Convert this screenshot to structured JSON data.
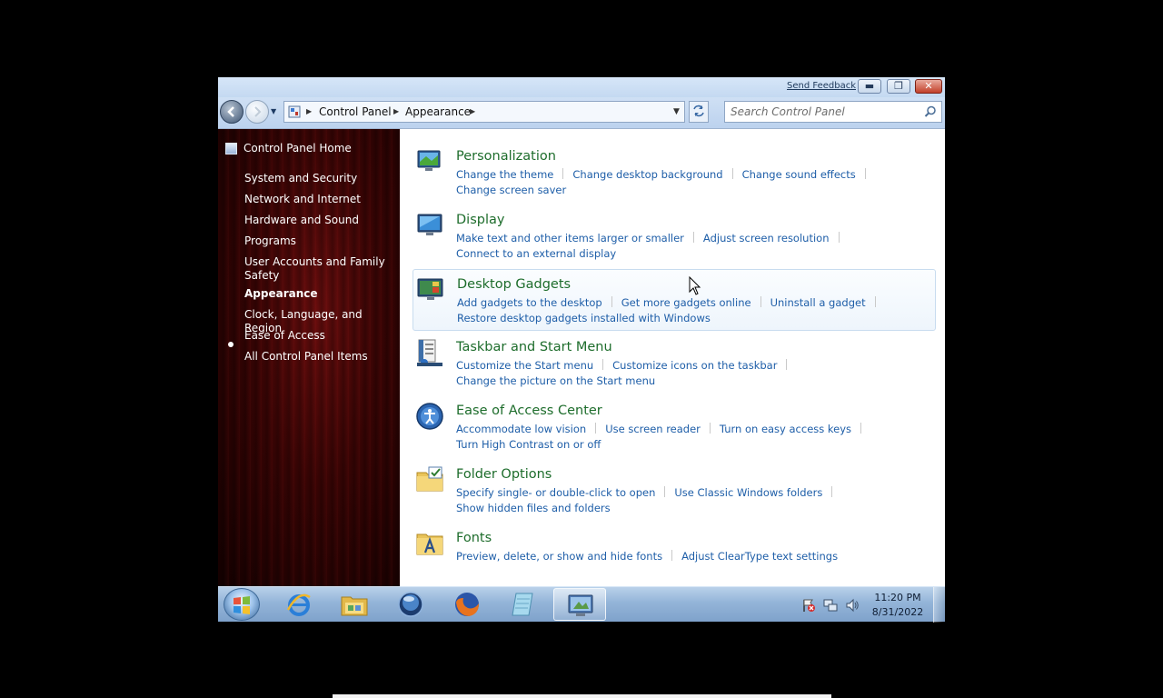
{
  "window": {
    "feedback_label": "Send Feedback",
    "caption": {
      "minimize_icon": "minimize-icon",
      "maximize_icon": "restore-icon",
      "close_icon": "close-icon"
    }
  },
  "navbar": {
    "breadcrumb": [
      "Control Panel",
      "Appearance"
    ],
    "search_placeholder": "Search Control Panel"
  },
  "sidebar": {
    "home_label": "Control Panel Home",
    "items": [
      "System and Security",
      "Network and Internet",
      "Hardware and Sound",
      "Programs",
      "User Accounts and Family Safety",
      "Appearance",
      "Clock, Language, and Region",
      "Ease of Access",
      "All Control Panel Items"
    ],
    "active_item": "Appearance"
  },
  "categories": [
    {
      "title": "Personalization",
      "icon": "personalization-icon",
      "links": [
        "Change the theme",
        "Change desktop background",
        "Change sound effects",
        "Change screen saver"
      ]
    },
    {
      "title": "Display",
      "icon": "display-icon",
      "links": [
        "Make text and other items larger or smaller",
        "Adjust screen resolution",
        "Connect to an external display"
      ]
    },
    {
      "title": "Desktop Gadgets",
      "icon": "gadgets-icon",
      "links": [
        "Add gadgets to the desktop",
        "Get more gadgets online",
        "Uninstall a gadget",
        "Restore desktop gadgets installed with Windows"
      ]
    },
    {
      "title": "Taskbar and Start Menu",
      "icon": "taskbar-icon",
      "links": [
        "Customize the Start menu",
        "Customize icons on the taskbar",
        "Change the picture on the Start menu"
      ]
    },
    {
      "title": "Ease of Access Center",
      "icon": "ease-of-access-icon",
      "links": [
        "Accommodate low vision",
        "Use screen reader",
        "Turn on easy access keys",
        "Turn High Contrast on or off"
      ]
    },
    {
      "title": "Folder Options",
      "icon": "folder-options-icon",
      "links": [
        "Specify single- or double-click to open",
        "Use Classic Windows folders",
        "Show hidden files and folders"
      ]
    },
    {
      "title": "Fonts",
      "icon": "fonts-icon",
      "links": [
        "Preview, delete, or show and hide fonts",
        "Adjust ClearType text settings"
      ]
    }
  ],
  "taskbar": {
    "pinned": [
      "internet-explorer-icon",
      "windows-explorer-icon",
      "media-player-icon",
      "firefox-icon",
      "notepad-icon",
      "control-panel-icon"
    ],
    "active_app": "control-panel-icon",
    "clock": {
      "time": "11:20 PM",
      "date": "8/31/2022"
    },
    "tray": [
      "action-center-icon",
      "network-icon",
      "volume-icon"
    ]
  },
  "colors": {
    "link": "#1e5ea8",
    "category_title": "#1e6d2c",
    "sidebar_bg": "#3a0404"
  }
}
